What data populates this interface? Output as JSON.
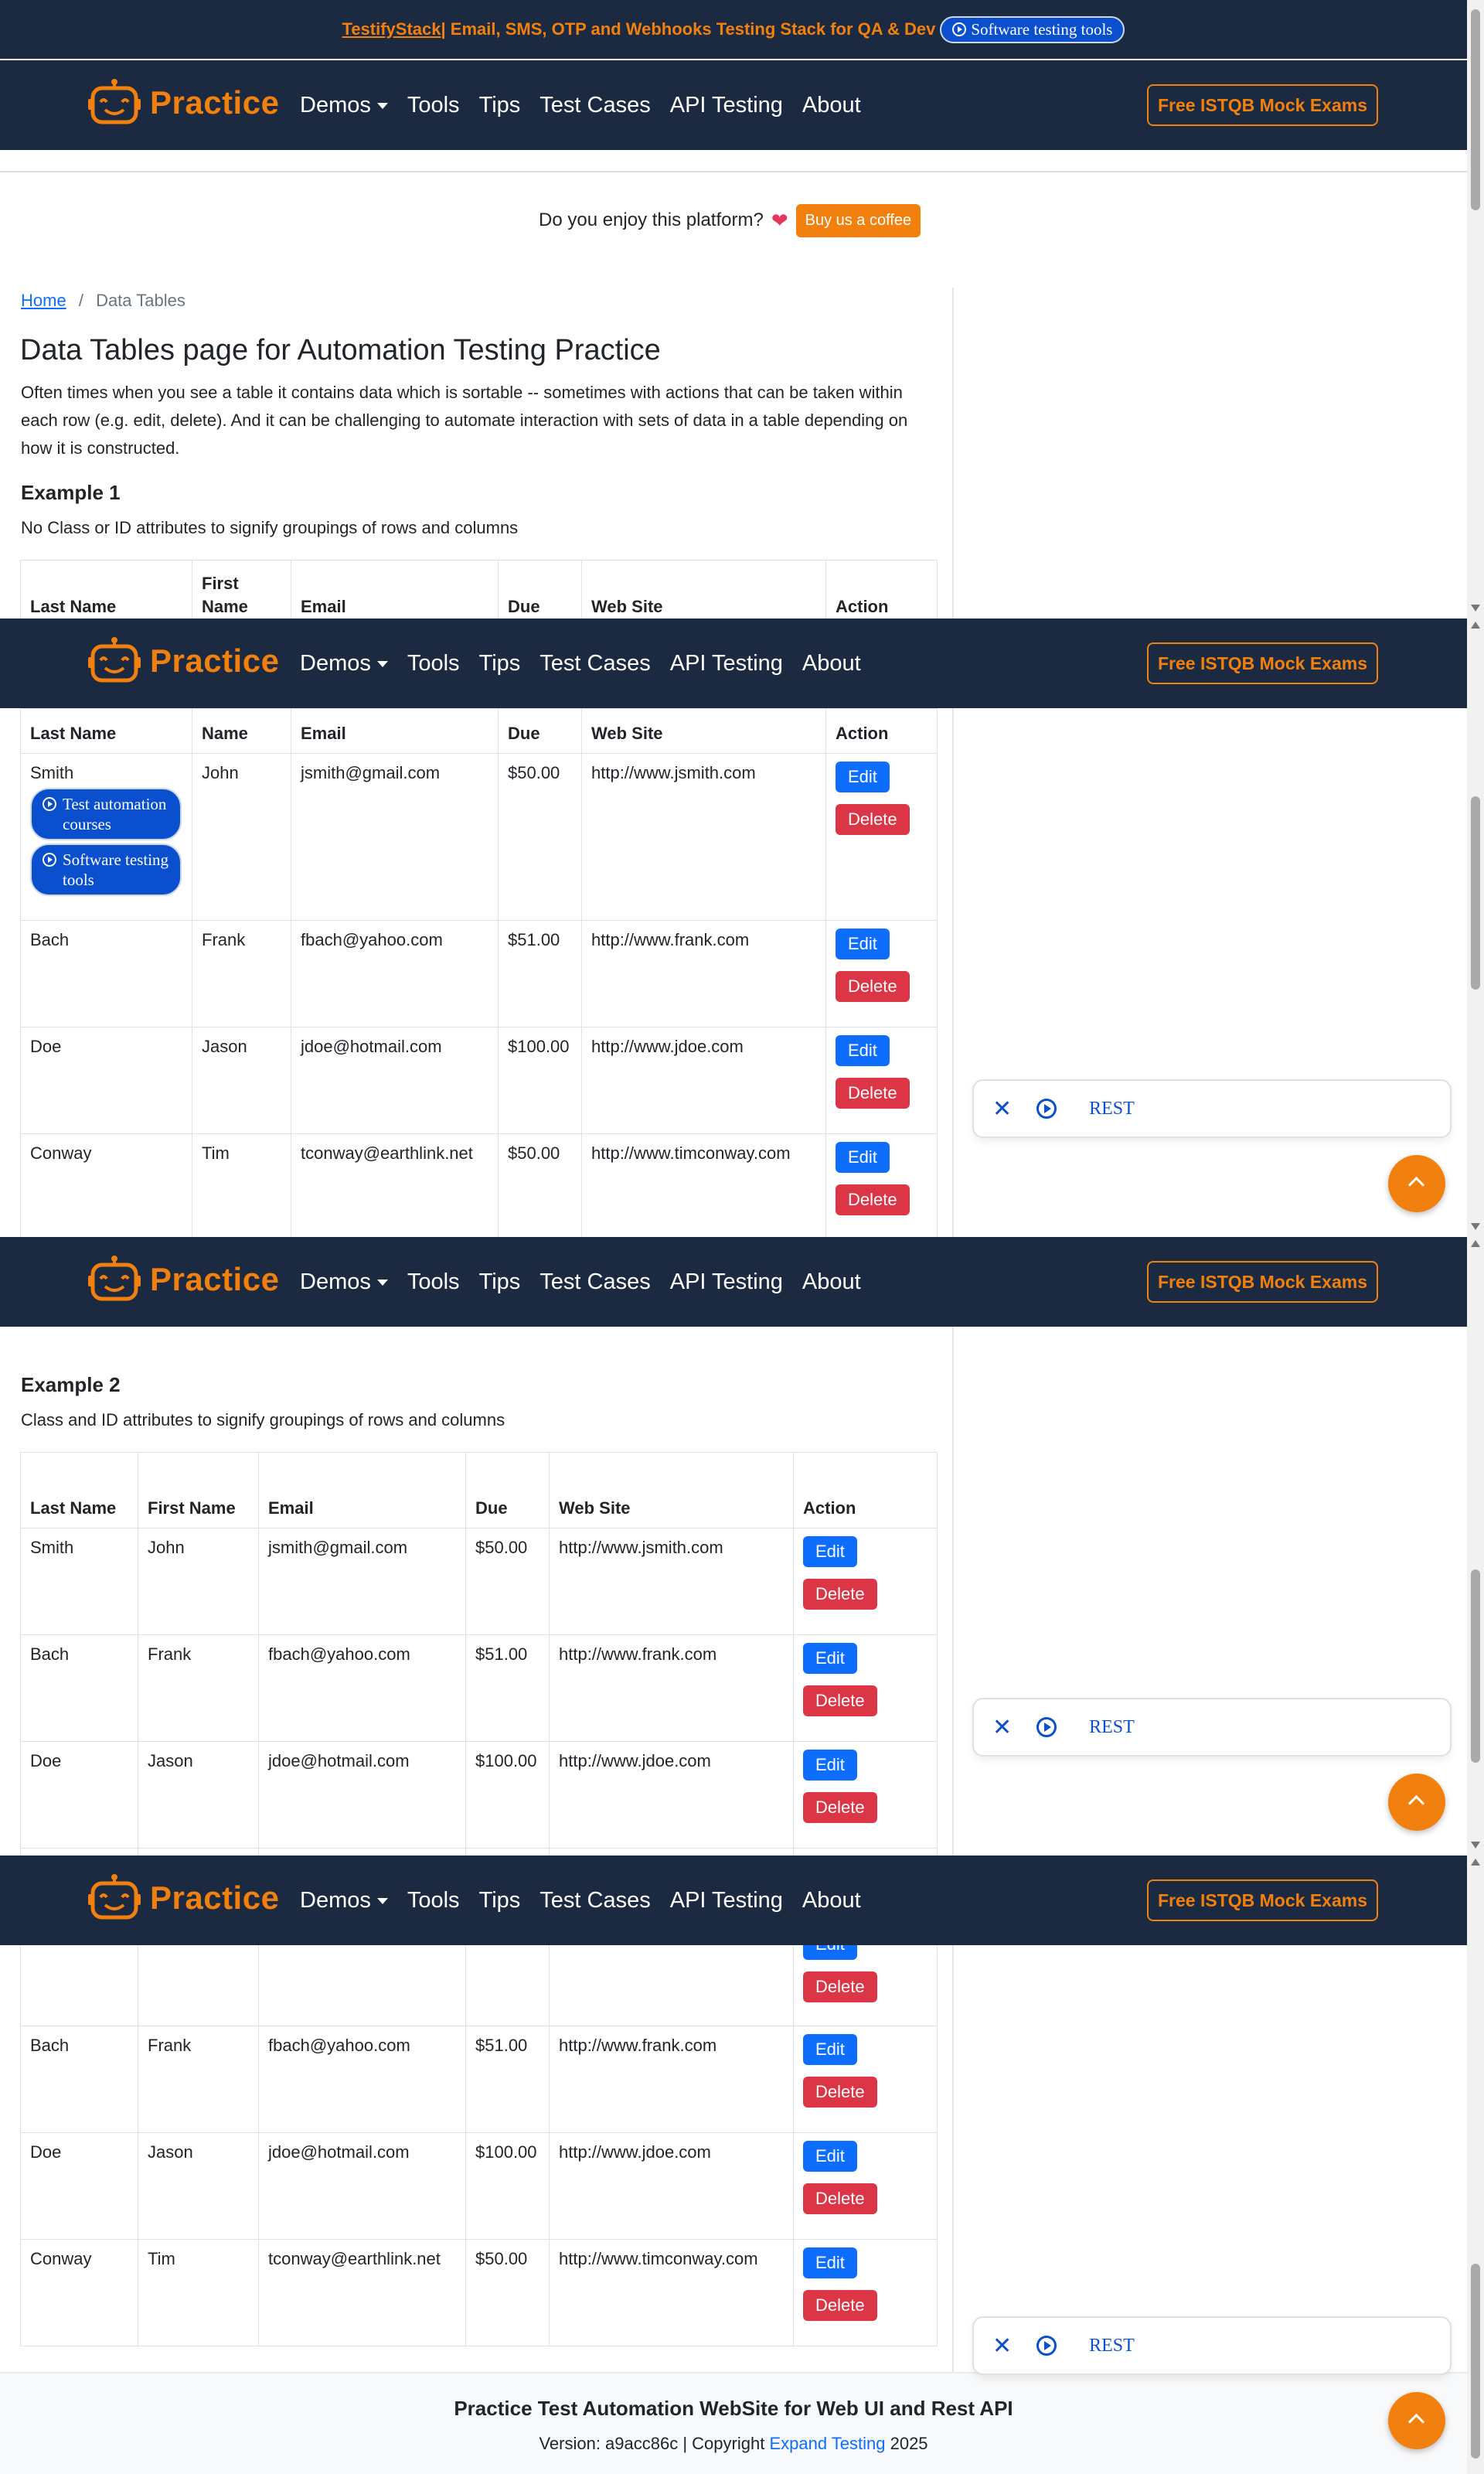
{
  "banner": {
    "link": "TestifyStack",
    "text": " | Email, SMS, OTP and Webhooks Testing Stack for QA & Dev",
    "pill": "Software testing tools"
  },
  "nav": {
    "brand": "Practice",
    "links": [
      "Demos",
      "Tools",
      "Tips",
      "Test Cases",
      "API Testing",
      "About"
    ],
    "cta": "Free ISTQB Mock Exams"
  },
  "coffee": {
    "text": "Do you enjoy this platform?",
    "button": "Buy us a coffee"
  },
  "breadcrumb": {
    "home": "Home",
    "sep": "/",
    "current": "Data Tables"
  },
  "page": {
    "title": "Data Tables page for Automation Testing Practice",
    "intro": "Often times when you see a table it contains data which is sortable -- sometimes with actions that can be taken within each row (e.g. edit, delete). And it can be challenging to automate interaction with sets of data in a table depending on how it is constructed."
  },
  "example1": {
    "title": "Example 1",
    "desc": "No Class or ID attributes to signify groupings of rows and columns",
    "headers": [
      "Last Name",
      "First Name",
      "Email",
      "Due",
      "Web Site",
      "Action"
    ],
    "sticky_headers": [
      "Last Name",
      "Name",
      "Email",
      "Due",
      "Web Site",
      "Action"
    ],
    "ads": [
      "Test automation courses",
      "Software testing tools"
    ]
  },
  "example2": {
    "title": "Example 2",
    "desc": "Class and ID attributes to signify groupings of rows and columns",
    "headers": [
      "Last Name",
      "First Name",
      "Email",
      "Due",
      "Web Site",
      "Action"
    ]
  },
  "rows": [
    {
      "last": "Smith",
      "first": "John",
      "email": "jsmith@gmail.com",
      "due": "$50.00",
      "web": "http://www.jsmith.com"
    },
    {
      "last": "Bach",
      "first": "Frank",
      "email": "fbach@yahoo.com",
      "due": "$51.00",
      "web": "http://www.frank.com"
    },
    {
      "last": "Doe",
      "first": "Jason",
      "email": "jdoe@hotmail.com",
      "due": "$100.00",
      "web": "http://www.jdoe.com"
    },
    {
      "last": "Conway",
      "first": "Tim",
      "email": "tconway@earthlink.net",
      "due": "$50.00",
      "web": "http://www.timconway.com"
    }
  ],
  "actions": {
    "edit": "Edit",
    "delete": "Delete"
  },
  "widget": {
    "label": "REST"
  },
  "footer": {
    "title": "Practice Test Automation WebSite for Web UI and Rest API",
    "version_prefix": "Version: a9acc86c | Copyright ",
    "company": "Expand Testing",
    "year": " 2025"
  },
  "colors": {
    "navy": "#1b2a40",
    "accent": "#f2800e",
    "edit": "#0d6efd",
    "delete": "#dc3545",
    "pill": "#0a4fce"
  }
}
